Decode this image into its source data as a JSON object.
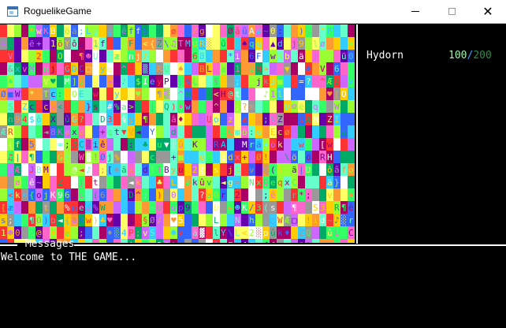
{
  "window": {
    "title": "RoguelikeGame",
    "controls": {
      "minimize": "minimize",
      "maximize": "maximize",
      "close": "✕"
    }
  },
  "map": {
    "description_colors": [
      "#ff3333",
      "#33ff66",
      "#3366ff",
      "#ffcc00",
      "#ff66cc",
      "#33ccff",
      "#99ff33",
      "#cc66ff",
      "#ff9933",
      "#66ffcc",
      "#ffffff",
      "#999999",
      "#00aa66",
      "#aa0066",
      "#6600aa",
      "#ffff66"
    ],
    "glyphs": "@#$%&*+=?!:;~^ABCDEFGHIJKLMNOPQRSTUVWXYZabcdefghijklmnopqrstuvwxyz0123456789<>[]{}()/|\\♦♣♠♥▲▼►◄■□▒▓░☺☻♪♫§¶ÆæâêôûäëöüØø"
  },
  "sidebar": {
    "hero_name": "Hydorn",
    "hp_current": "100",
    "hp_separator": "/",
    "hp_max": "200"
  },
  "messages": {
    "title": " Messages ",
    "lines": [
      "Welcome to THE GAME..."
    ]
  }
}
